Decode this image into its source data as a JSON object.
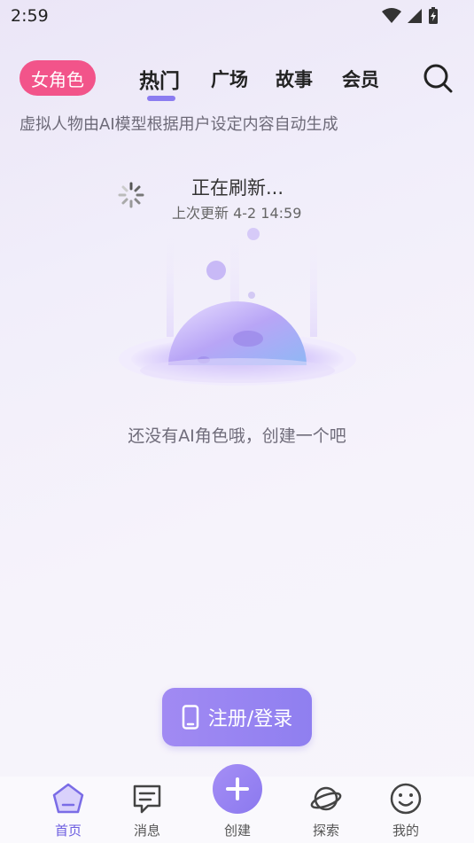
{
  "status": {
    "time": "2:59"
  },
  "top": {
    "gender": "女角色",
    "tabs": [
      "热门",
      "广场",
      "故事",
      "会员"
    ],
    "active_tab": "热门"
  },
  "subtitle": "虚拟人物由AI模型根据用户设定内容自动生成",
  "refresh": {
    "title": "正在刷新...",
    "last_update": "上次更新 4-2 14:59"
  },
  "empty": {
    "text": "还没有AI角色哦，创建一个吧"
  },
  "login_button": {
    "label": "注册/登录"
  },
  "bottom_nav": {
    "home": "首页",
    "messages": "消息",
    "create": "创建",
    "explore": "探索",
    "me": "我的"
  },
  "colors": {
    "accent": "#8b7cf0",
    "pill": "#f2548a"
  }
}
